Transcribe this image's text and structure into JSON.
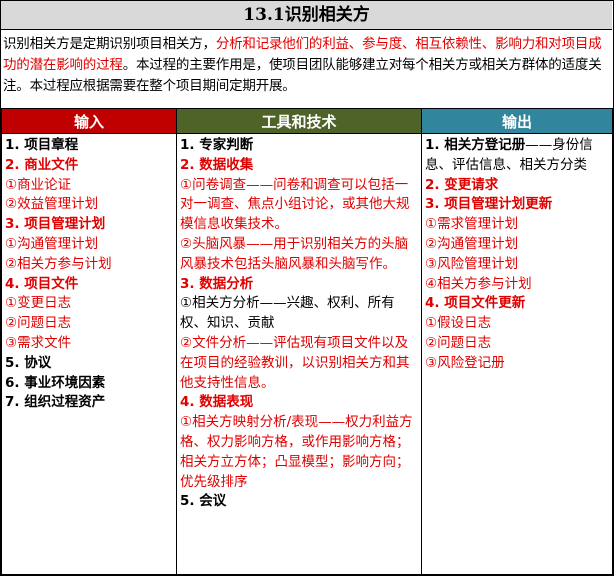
{
  "title": "13.1识别相关方",
  "description": {
    "part1": "识别相关方是定期识别项目相关方，",
    "highlight": "分析和记录他们的利益、参与度、相互依赖性、影响力和对项目成功的潜在影响的过程",
    "part2": "。本过程的主要作用是，使项目团队能够建立对每个相关方或相关方群体的适度关注。本过程应根据需要在整个项目期间定期开展。"
  },
  "headers": {
    "inputs": "输入",
    "tools": "工具和技术",
    "outputs": "输出"
  },
  "inputs": [
    {
      "text": "1. 项目章程",
      "bold": true,
      "red": false
    },
    {
      "text": "2. 商业文件",
      "bold": true,
      "red": true
    },
    {
      "text": "①商业论证",
      "bold": false,
      "red": true
    },
    {
      "text": "②效益管理计划",
      "bold": false,
      "red": true
    },
    {
      "text": "3. 项目管理计划",
      "bold": true,
      "red": true
    },
    {
      "text": "①沟通管理计划",
      "bold": false,
      "red": true
    },
    {
      "text": "②相关方参与计划",
      "bold": false,
      "red": true
    },
    {
      "text": "4. 项目文件",
      "bold": true,
      "red": true
    },
    {
      "text": "①变更日志",
      "bold": false,
      "red": true
    },
    {
      "text": "②问题日志",
      "bold": false,
      "red": true
    },
    {
      "text": "③需求文件",
      "bold": false,
      "red": true
    },
    {
      "text": "5. 协议",
      "bold": true,
      "red": false
    },
    {
      "text": "6. 事业环境因素",
      "bold": true,
      "red": false
    },
    {
      "text": "7. 组织过程资产",
      "bold": true,
      "red": false
    }
  ],
  "tools": [
    {
      "text": "1. 专家判断",
      "bold": true,
      "red": false
    },
    {
      "text": "2. 数据收集",
      "bold": true,
      "red": true
    },
    {
      "text": "①问卷调查——问卷和调查可以包括一对一调查、焦点小组讨论，或其他大规模信息收集技术。",
      "bold": false,
      "red": true
    },
    {
      "text": "②头脑风暴——用于识别相关方的头脑风暴技术包括头脑风暴和头脑写作。",
      "bold": false,
      "red": true
    },
    {
      "text": "3. 数据分析",
      "bold": true,
      "red": true
    },
    {
      "text": "①相关方分析——兴趣、权利、所有权、知识、贡献",
      "bold": false,
      "red": false
    },
    {
      "text": "②文件分析——评估现有项目文件以及在项目的经验教训，以识别相关方和其他支持性信息。",
      "bold": false,
      "red": true
    },
    {
      "text": "4. 数据表现",
      "bold": true,
      "red": true
    },
    {
      "text": "①相关方映射分析/表现——权力利益方格、权力影响方格，或作用影响方格；相关方立方体；凸显模型；影响方向；优先级排序",
      "bold": false,
      "red": true
    },
    {
      "text": "5. 会议",
      "bold": true,
      "red": false
    }
  ],
  "outputs": [
    {
      "text": "1. 相关方登记册",
      "bold": true,
      "red": false
    },
    {
      "text": "——身份信息、评估信息、相关方分类",
      "bold": false,
      "red": false,
      "inline": true
    },
    {
      "text": "2. 变更请求",
      "bold": true,
      "red": true
    },
    {
      "text": "3. 项目管理计划更新",
      "bold": true,
      "red": true
    },
    {
      "text": "①需求管理计划",
      "bold": false,
      "red": true
    },
    {
      "text": "②沟通管理计划",
      "bold": false,
      "red": true
    },
    {
      "text": "③风险管理计划",
      "bold": false,
      "red": true
    },
    {
      "text": "④相关方参与计划",
      "bold": false,
      "red": true
    },
    {
      "text": "4. 项目文件更新",
      "bold": true,
      "red": true
    },
    {
      "text": "①假设日志",
      "bold": false,
      "red": true
    },
    {
      "text": "②问题日志",
      "bold": false,
      "red": true
    },
    {
      "text": "③风险登记册",
      "bold": false,
      "red": true
    }
  ],
  "colors": {
    "title_bg": "#d9d9d9",
    "inputs_header": "#c00000",
    "tools_header": "#4f6228",
    "outputs_header": "#31859c",
    "highlight": "#e00000"
  }
}
